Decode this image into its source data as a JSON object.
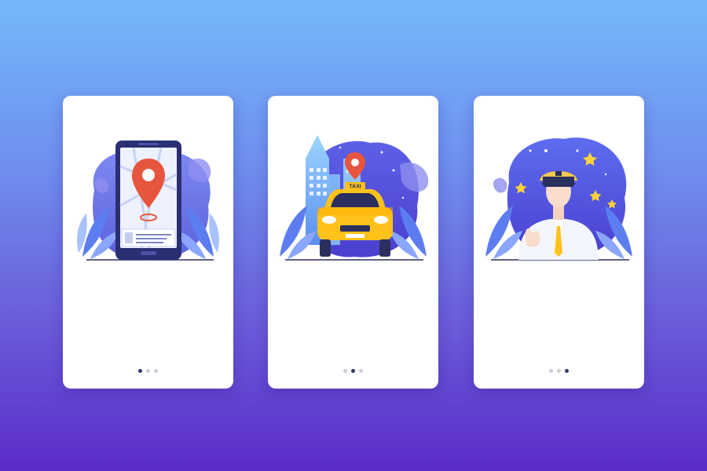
{
  "background": {
    "gradient_top": "#74b9f9",
    "gradient_bottom": "#5a2bc9"
  },
  "screens": [
    {
      "illustration": "smartphone-map-location-pin",
      "pager": {
        "total": 3,
        "active_index": 0
      }
    },
    {
      "illustration": "yellow-taxi-city",
      "taxi_sign": "TAXI",
      "pager": {
        "total": 3,
        "active_index": 1
      }
    },
    {
      "illustration": "taxi-driver-thumbs-up-stars",
      "pager": {
        "total": 3,
        "active_index": 2
      }
    }
  ],
  "colors": {
    "accent_blue": "#4b5be0",
    "pin_red": "#e8553d",
    "taxi_yellow": "#ffc21a",
    "dot_active": "#2e3b6e",
    "dot_inactive": "#c9cdda"
  }
}
